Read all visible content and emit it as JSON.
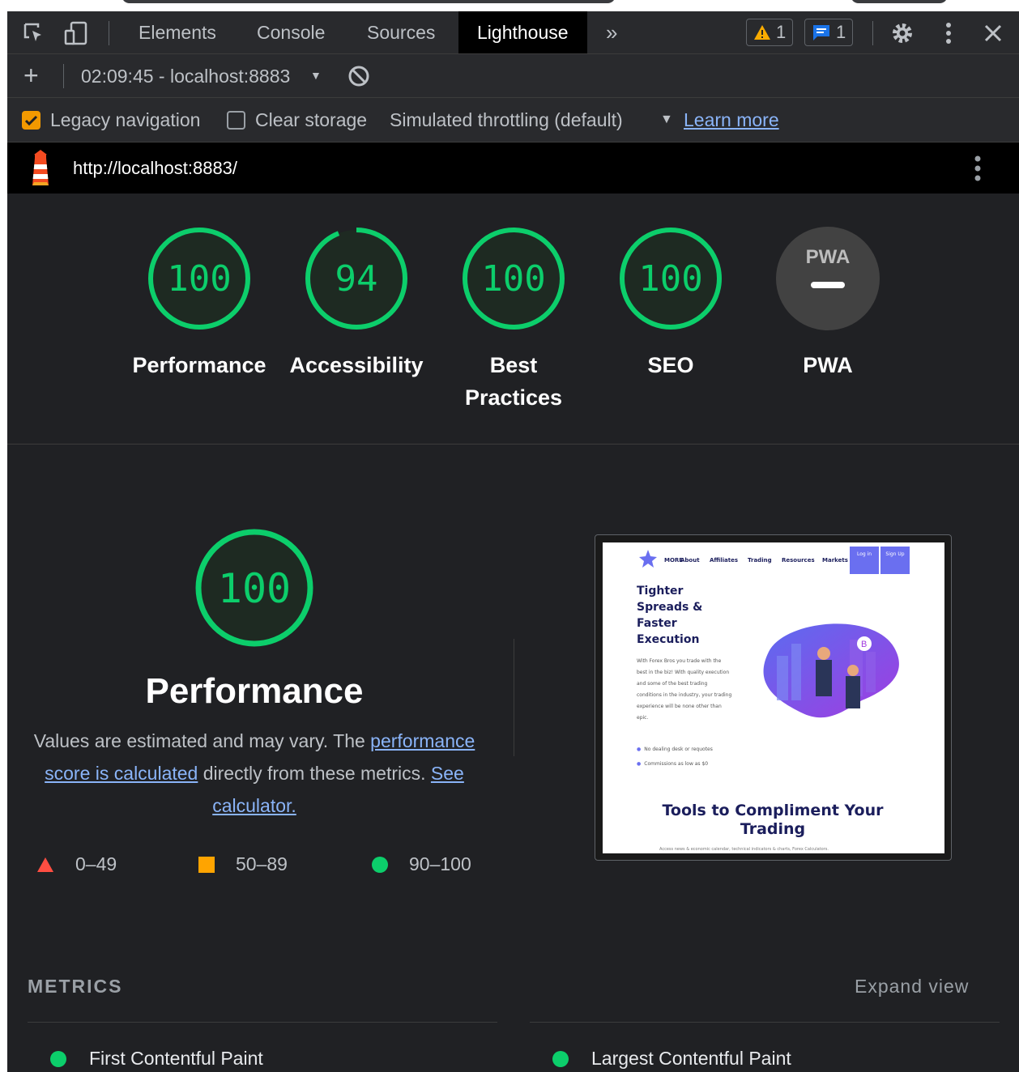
{
  "tabbar": {
    "tabs": [
      "Elements",
      "Console",
      "Sources",
      "Lighthouse"
    ],
    "active_tab": "Lighthouse",
    "overflow": "»",
    "warnings_count": "1",
    "messages_count": "1"
  },
  "report": {
    "selected": "02:09:45 - localhost:8883"
  },
  "settings": {
    "legacy_navigation": "Legacy navigation",
    "clear_storage": "Clear storage",
    "throttling": "Simulated throttling (default)",
    "learn_more": "Learn more"
  },
  "url": "http://localhost:8883/",
  "categories": [
    {
      "label": "Performance",
      "score": "100",
      "value": 100
    },
    {
      "label": "Accessibility",
      "score": "94",
      "value": 94
    },
    {
      "label": "Best Practices",
      "score": "100",
      "value": 100
    },
    {
      "label": "SEO",
      "score": "100",
      "value": 100
    },
    {
      "label": "PWA",
      "score": "PWA",
      "value": null
    }
  ],
  "performance": {
    "score": "100",
    "title": "Performance",
    "desc_prefix": "Values are estimated and may vary. The",
    "desc_link": "performance score is calculated",
    "desc_mid": "directly from these metrics.",
    "see_calculator": "See calculator.",
    "legend": [
      "0–49",
      "50–89",
      "90–100"
    ]
  },
  "screenshot": {
    "nav": [
      "MORE",
      "About",
      "Affiliates",
      "Trading",
      "Resources",
      "Markets"
    ],
    "login": "Log in",
    "signup": "Sign Up",
    "headline": "Tighter Spreads & Faster Execution",
    "body": "With Forex Bros you trade with the best in the biz! With quality execution and some of the best trading conditions in the industry, your trading experience will be none other than epic.",
    "bullet1": "No dealing desk or requotes",
    "bullet2": "Commissions as low as $0",
    "tools": "Tools to Compliment Your Trading",
    "footer": "Access news & economic calendar, technical indicators & charts, Forex Calculators."
  },
  "metrics": {
    "title": "METRICS",
    "expand": "Expand view",
    "items": [
      "First Contentful Paint",
      "Largest Contentful Paint"
    ]
  },
  "colors": {
    "pass": "#0cce6b",
    "average": "#ffa400",
    "fail": "#ff4e42",
    "accent_link": "#8ab4f8"
  }
}
